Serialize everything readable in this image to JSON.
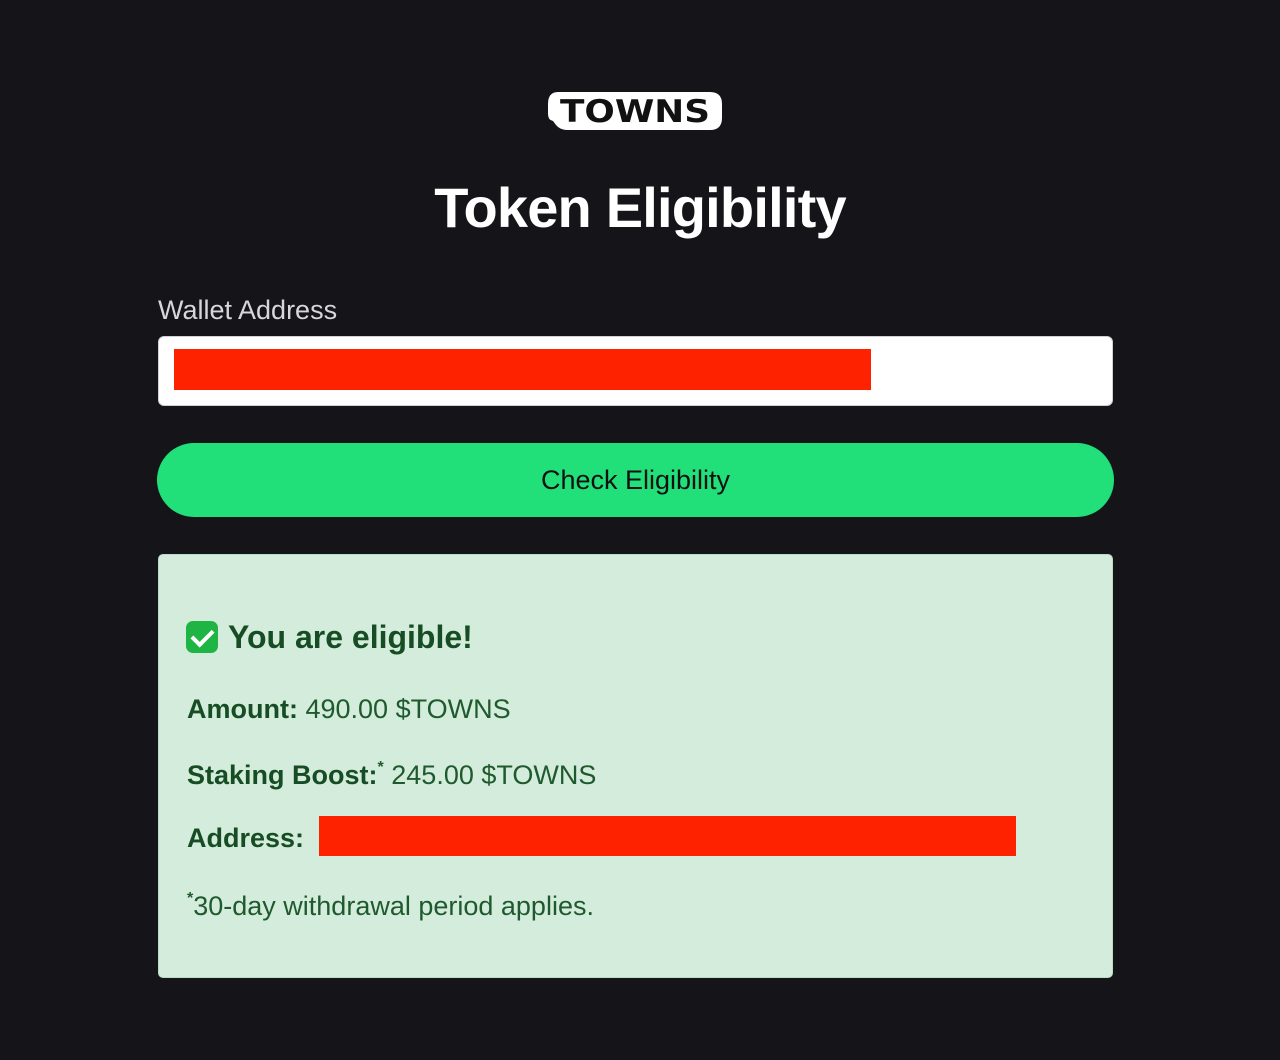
{
  "brand": {
    "logo_text": "TOWNS"
  },
  "page": {
    "title": "Token Eligibility"
  },
  "form": {
    "wallet_label": "Wallet Address",
    "wallet_value_redacted": true,
    "submit_label": "Check Eligibility"
  },
  "result": {
    "status_icon": "check-mark-icon",
    "title": "You are eligible!",
    "amount_label": "Amount:",
    "amount_value": "490.00 $TOWNS",
    "staking_label": "Staking Boost:",
    "staking_marker": "*",
    "staking_value": "245.00 $TOWNS",
    "address_label": "Address:",
    "address_redacted": true,
    "footnote_marker": "*",
    "footnote": "30-day withdrawal period applies."
  },
  "colors": {
    "background": "#151519",
    "accent_button": "#21e07a",
    "success_panel": "#d4ecdb",
    "success_text": "#174d24",
    "redaction": "#ff2200"
  }
}
